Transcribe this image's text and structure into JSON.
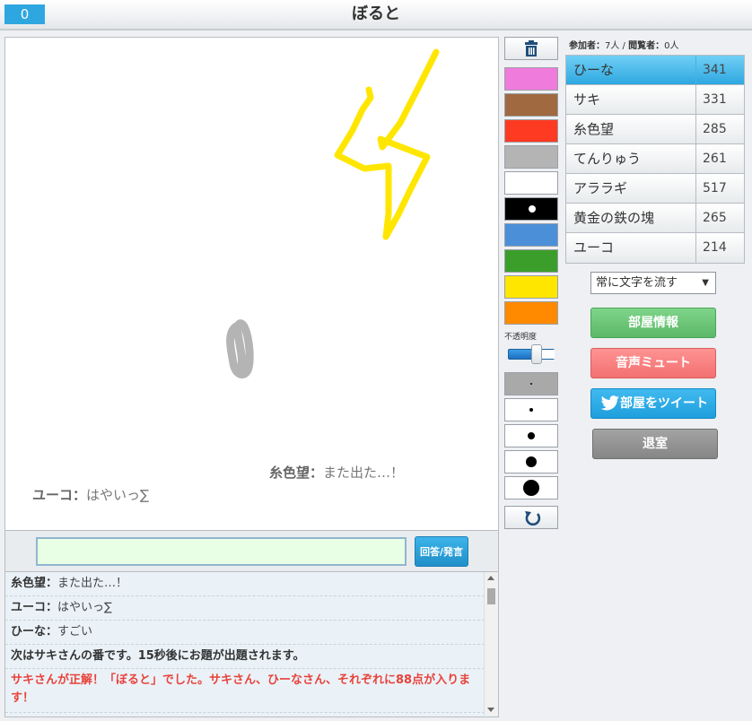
{
  "header": {
    "score": "0",
    "title": "ぼると"
  },
  "canvas_messages": [
    {
      "name": "糸色望：",
      "text": "また出た…！"
    },
    {
      "name": "ユーコ：",
      "text": "はやいっ∑"
    }
  ],
  "input": {
    "value": "",
    "button_label": "回答/発言"
  },
  "log": [
    {
      "type": "chat",
      "name": "糸色望：",
      "text": "また出た…！"
    },
    {
      "type": "chat",
      "name": "ユーコ：",
      "text": "はやいっ∑"
    },
    {
      "type": "chat",
      "name": "ひーな：",
      "text": "すごい"
    },
    {
      "type": "system",
      "text": "次はサキさんの番です。15秒後にお題が出題されます。"
    },
    {
      "type": "correct",
      "text": "サキさんが正解！「ぼると」でした。サキさん、ひーなさん、それぞれに88点が入ります！"
    }
  ],
  "palette": [
    "#ef7bdc",
    "#a06940",
    "#ff3a22",
    "#b4b4b4",
    "#ffffff",
    "#000000",
    "#4b8fd8",
    "#3c9e2a",
    "#ffe600",
    "#ff8a00"
  ],
  "opacity": {
    "label": "不透明度",
    "value": 0.65
  },
  "pen_sizes": [
    "extra-small",
    "small",
    "medium",
    "large",
    "extra-large"
  ],
  "participants": {
    "label_participants": "参加者：",
    "participants_count": "7人",
    "separator": " / ",
    "label_viewers": "閲覧者：",
    "viewers_count": "0人"
  },
  "players": [
    {
      "name": "ひーな",
      "score": "341",
      "active": true
    },
    {
      "name": "サキ",
      "score": "331",
      "active": false
    },
    {
      "name": "糸色望",
      "score": "285",
      "active": false
    },
    {
      "name": "てんりゅう",
      "score": "261",
      "active": false
    },
    {
      "name": "アララギ",
      "score": "517",
      "active": false
    },
    {
      "name": "黄金の鉄の塊",
      "score": "265",
      "active": false
    },
    {
      "name": "ユーコ",
      "score": "214",
      "active": false
    }
  ],
  "flow_select": {
    "selected": "常に文字を流す"
  },
  "buttons": {
    "room_info": "部屋情報",
    "mute": "音声ミュート",
    "tweet": "部屋をツイート",
    "exit": "退室"
  },
  "colors": {
    "accent": "#2ea7e0",
    "stroke_yellow": "#ffe600",
    "stroke_gray": "#b4b4b4"
  }
}
